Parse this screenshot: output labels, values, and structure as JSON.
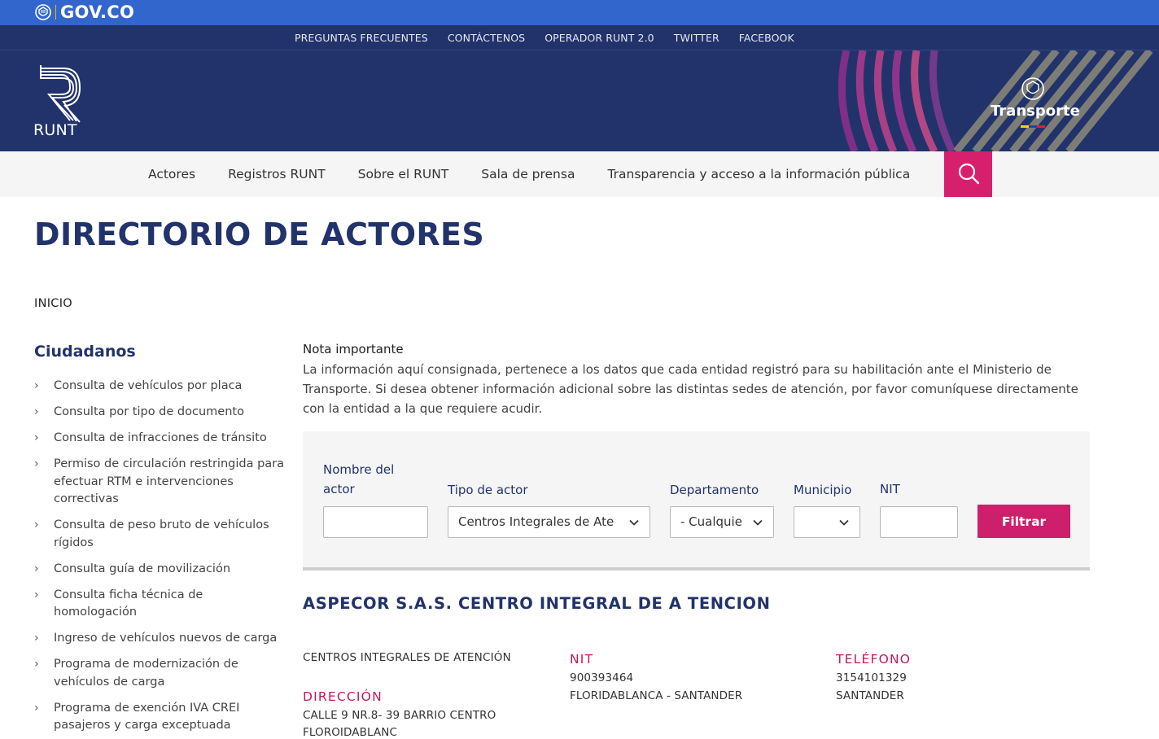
{
  "gov_bar": {
    "logo_text": "GOV.CO"
  },
  "utility_nav": [
    "PREGUNTAS FRECUENTES",
    "CONTÁCTENOS",
    "OPERADOR RUNT 2.0",
    "TWITTER",
    "FACEBOOK"
  ],
  "header": {
    "logo_text": "RUNT",
    "ministry_text": "Transporte"
  },
  "main_nav": [
    "Actores",
    "Registros RUNT",
    "Sobre el RUNT",
    "Sala de prensa",
    "Transparencia y acceso a la información pública"
  ],
  "page": {
    "title": "DIRECTORIO DE ACTORES",
    "breadcrumb": "INICIO"
  },
  "sidebar": {
    "title": "Ciudadanos",
    "items": [
      "Consulta de vehículos por placa",
      "Consulta por tipo de documento",
      "Consulta de infracciones de tránsito",
      "Permiso de circulación restringida para efectuar RTM e intervenciones correctivas",
      "Consulta de peso bruto de vehículos rígidos",
      "Consulta guía de movilización",
      "Consulta ficha técnica de homologación",
      "Ingreso de vehículos nuevos de carga",
      "Programa de modernización de vehículos de carga",
      "Programa de exención IVA CREI pasajeros y carga exceptuada"
    ]
  },
  "note": {
    "title": "Nota importante",
    "text": "La información aquí consignada, pertenece a los datos que cada entidad registró para su habilitación ante el Ministerio de Transporte. Si desea obtener información adicional sobre las distintas sedes de atención, por favor comuníquese directamente con la entidad a la que requiere acudir."
  },
  "filters": {
    "nombre_label": "Nombre del actor",
    "nombre_value": "",
    "tipo_label": "Tipo de actor",
    "tipo_value": "Centros Integrales de Ate",
    "departamento_label": "Departamento",
    "departamento_value": "- Cualquie",
    "municipio_label": "Municipio",
    "municipio_value": "",
    "nit_label": "NIT",
    "nit_value": "",
    "button_label": "Filtrar"
  },
  "result": {
    "name": "ASPECOR S.A.S. CENTRO INTEGRAL DE A TENCION",
    "type": "CENTROS INTEGRALES DE ATENCIÓN",
    "nit_label": "NIT",
    "nit_value": "900393464",
    "location": "FLORIDABLANCA - SANTANDER",
    "telefono_label": "TELÉFONO",
    "telefono_value": "3154101329",
    "departamento": "SANTANDER",
    "direccion_label": "DIRECCIÓN",
    "direccion_line1": "CALLE 9 NR.8- 39 BARRIO CENTRO",
    "direccion_line2": "FLOROIDABLANC"
  },
  "colors": {
    "gov_blue": "#3366cc",
    "navy": "#22336b",
    "magenta": "#d6206e",
    "label_pink": "#c2185b"
  }
}
